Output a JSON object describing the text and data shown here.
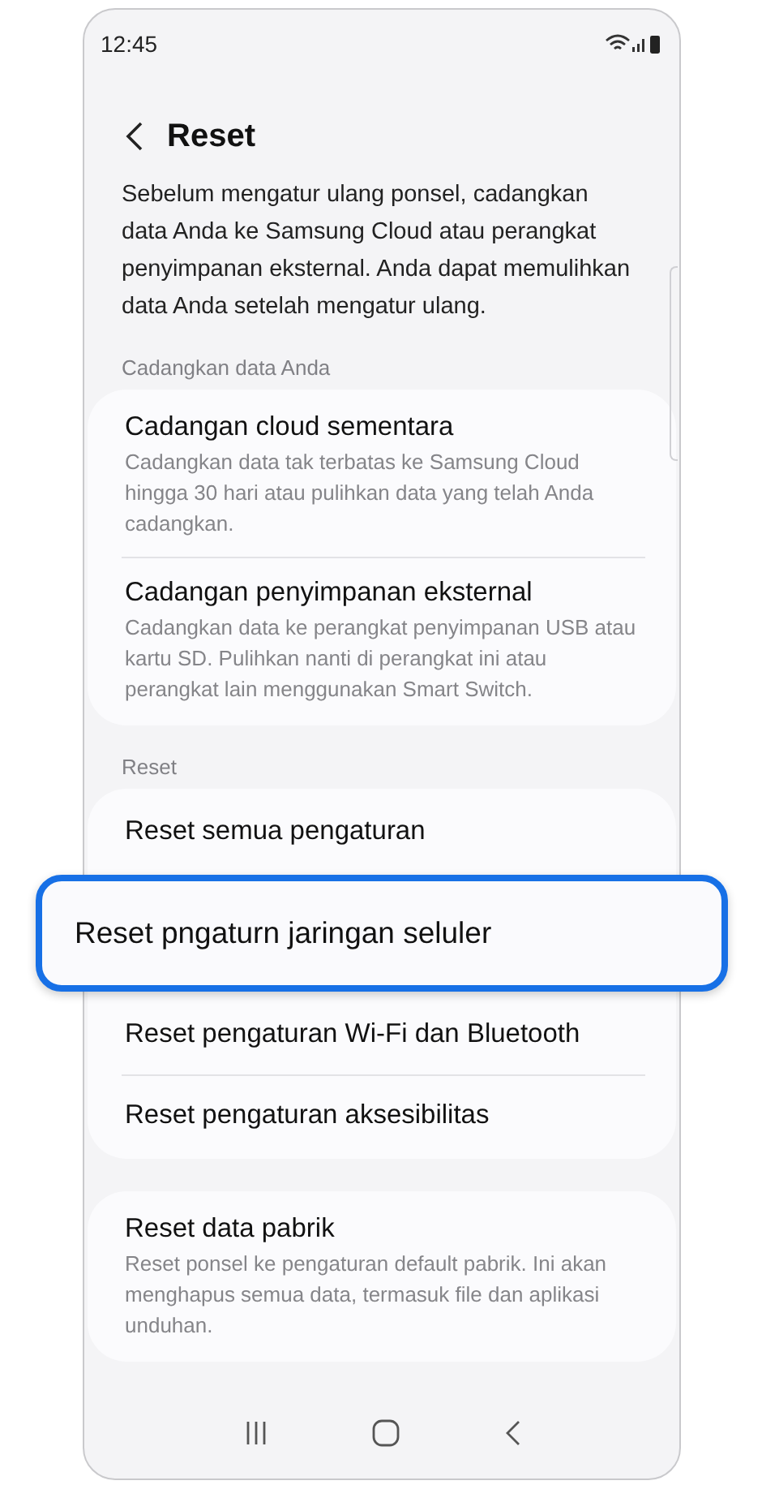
{
  "status_bar": {
    "time": "12:45"
  },
  "header": {
    "title": "Reset"
  },
  "intro": "Sebelum mengatur ulang ponsel, cadangkan data Anda ke Samsung Cloud atau perangkat penyimpanan eksternal. Anda dapat memulihkan data Anda setelah mengatur ulang.",
  "sections": [
    {
      "label": "Cadangkan data Anda",
      "items": [
        {
          "kind": "plain",
          "title": "Cadangan cloud sementara",
          "subtitle": "Cadangkan data tak terbatas ke Samsung Cloud hingga 30 hari atau pulihkan data yang telah Anda cadangkan."
        },
        {
          "kind": "plain",
          "title": "Cadangan penyimpanan eksternal",
          "subtitle": "Cadangkan data ke perangkat penyimpanan USB atau kartu SD. Pulihkan nanti di perangkat ini atau perangkat lain menggunakan Smart Switch."
        }
      ]
    },
    {
      "label": "Reset",
      "items": [
        {
          "kind": "plain",
          "title": "Reset semua pengaturan"
        },
        {
          "kind": "highlighted",
          "title": "Reset pngaturn jaringan seluler"
        },
        {
          "kind": "plain",
          "title": "Reset pengaturan Wi-Fi dan Bluetooth"
        },
        {
          "kind": "plain",
          "title": "Reset pengaturan aksesibilitas"
        }
      ]
    },
    {
      "items": [
        {
          "kind": "plain",
          "title": "Reset data pabrik",
          "subtitle": "Reset ponsel ke pengaturan default pabrik. Ini akan menghapus semua data, termasuk file dan aplikasi unduhan."
        }
      ]
    }
  ]
}
